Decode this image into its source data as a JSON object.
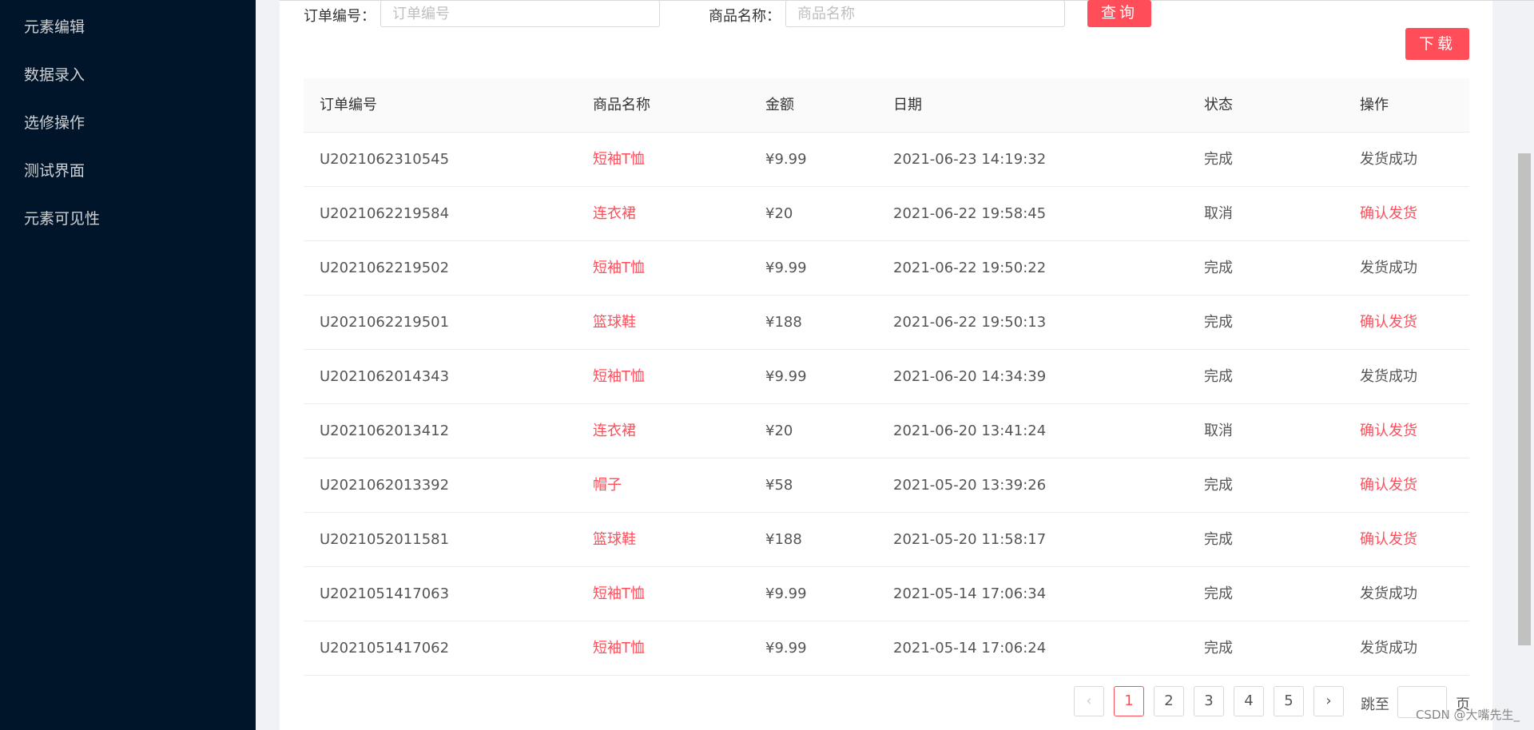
{
  "sidebar": {
    "items": [
      {
        "label": "元素编辑"
      },
      {
        "label": "数据录入"
      },
      {
        "label": "选修操作"
      },
      {
        "label": "测试界面"
      },
      {
        "label": "元素可见性"
      }
    ]
  },
  "search": {
    "order_label": "订单编号：",
    "order_placeholder": "订单编号",
    "product_label": "商品名称：",
    "product_placeholder": "商品名称",
    "query_button": "查询",
    "download_button": "下载"
  },
  "table": {
    "headers": {
      "order": "订单编号",
      "product": "商品名称",
      "amount": "金额",
      "date": "日期",
      "status": "状态",
      "action": "操作"
    },
    "rows": [
      {
        "order": "U2021062310545",
        "product": "短袖T恤",
        "amount": "¥9.99",
        "date": "2021-06-23 14:19:32",
        "status": "完成",
        "action": "发货成功"
      },
      {
        "order": "U2021062219584",
        "product": "连衣裙",
        "amount": "¥20",
        "date": "2021-06-22 19:58:45",
        "status": "取消",
        "action": "确认发货"
      },
      {
        "order": "U2021062219502",
        "product": "短袖T恤",
        "amount": "¥9.99",
        "date": "2021-06-22 19:50:22",
        "status": "完成",
        "action": "发货成功"
      },
      {
        "order": "U2021062219501",
        "product": "篮球鞋",
        "amount": "¥188",
        "date": "2021-06-22 19:50:13",
        "status": "完成",
        "action": "确认发货"
      },
      {
        "order": "U2021062014343",
        "product": "短袖T恤",
        "amount": "¥9.99",
        "date": "2021-06-20 14:34:39",
        "status": "完成",
        "action": "发货成功"
      },
      {
        "order": "U2021062013412",
        "product": "连衣裙",
        "amount": "¥20",
        "date": "2021-06-20 13:41:24",
        "status": "取消",
        "action": "确认发货"
      },
      {
        "order": "U2021062013392",
        "product": "帽子",
        "amount": "¥58",
        "date": "2021-05-20 13:39:26",
        "status": "完成",
        "action": "确认发货"
      },
      {
        "order": "U2021052011581",
        "product": "篮球鞋",
        "amount": "¥188",
        "date": "2021-05-20 11:58:17",
        "status": "完成",
        "action": "确认发货"
      },
      {
        "order": "U2021051417063",
        "product": "短袖T恤",
        "amount": "¥9.99",
        "date": "2021-05-14 17:06:34",
        "status": "完成",
        "action": "发货成功"
      },
      {
        "order": "U2021051417062",
        "product": "短袖T恤",
        "amount": "¥9.99",
        "date": "2021-05-14 17:06:24",
        "status": "完成",
        "action": "发货成功"
      }
    ]
  },
  "pagination": {
    "prev_icon": "‹",
    "next_icon": "›",
    "pages": [
      "1",
      "2",
      "3",
      "4",
      "5"
    ],
    "current": "1",
    "jump_label": "跳至",
    "page_suffix": "页"
  },
  "watermark": "CSDN @大嘴先生_",
  "colors": {
    "sidebar_bg": "#001529",
    "accent": "#ff4d5a"
  }
}
